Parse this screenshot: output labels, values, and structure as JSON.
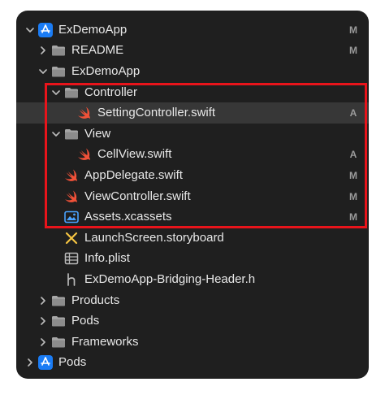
{
  "navigator": {
    "rows": [
      {
        "label": "ExDemoApp",
        "badge": "M",
        "icon": "app-project-icon",
        "chevron": "down"
      },
      {
        "label": "README",
        "badge": "M",
        "icon": "folder-icon",
        "chevron": "right"
      },
      {
        "label": "ExDemoApp",
        "badge": "",
        "icon": "folder-icon",
        "chevron": "down"
      },
      {
        "label": "Controller",
        "badge": "",
        "icon": "folder-icon",
        "chevron": "down"
      },
      {
        "label": "SettingController.swift",
        "badge": "A",
        "icon": "swift-file-icon",
        "chevron": "none"
      },
      {
        "label": "View",
        "badge": "",
        "icon": "folder-icon",
        "chevron": "down"
      },
      {
        "label": "CellView.swift",
        "badge": "A",
        "icon": "swift-file-icon",
        "chevron": "none"
      },
      {
        "label": "AppDelegate.swift",
        "badge": "M",
        "icon": "swift-file-icon",
        "chevron": "none"
      },
      {
        "label": "ViewController.swift",
        "badge": "M",
        "icon": "swift-file-icon",
        "chevron": "none"
      },
      {
        "label": "Assets.xcassets",
        "badge": "M",
        "icon": "asset-catalog-icon",
        "chevron": "none"
      },
      {
        "label": "LaunchScreen.storyboard",
        "badge": "",
        "icon": "storyboard-icon",
        "chevron": "none"
      },
      {
        "label": "Info.plist",
        "badge": "",
        "icon": "plist-icon",
        "chevron": "none"
      },
      {
        "label": "ExDemoApp-Bridging-Header.h",
        "badge": "",
        "icon": "header-file-icon",
        "chevron": "none"
      },
      {
        "label": "Products",
        "badge": "",
        "icon": "folder-icon",
        "chevron": "right"
      },
      {
        "label": "Pods",
        "badge": "",
        "icon": "folder-icon",
        "chevron": "right"
      },
      {
        "label": "Frameworks",
        "badge": "",
        "icon": "folder-icon",
        "chevron": "right"
      },
      {
        "label": "Pods",
        "badge": "",
        "icon": "app-project-icon",
        "chevron": "right"
      }
    ]
  },
  "colors": {
    "panel_background": "#1f1f1f",
    "text": "#e8e8e8",
    "badge": "#9a9a9a",
    "highlight_border": "#e8141b",
    "folder": "#a7a7a7",
    "swift": "#f05138",
    "app_icon": "#1a7cf5"
  }
}
